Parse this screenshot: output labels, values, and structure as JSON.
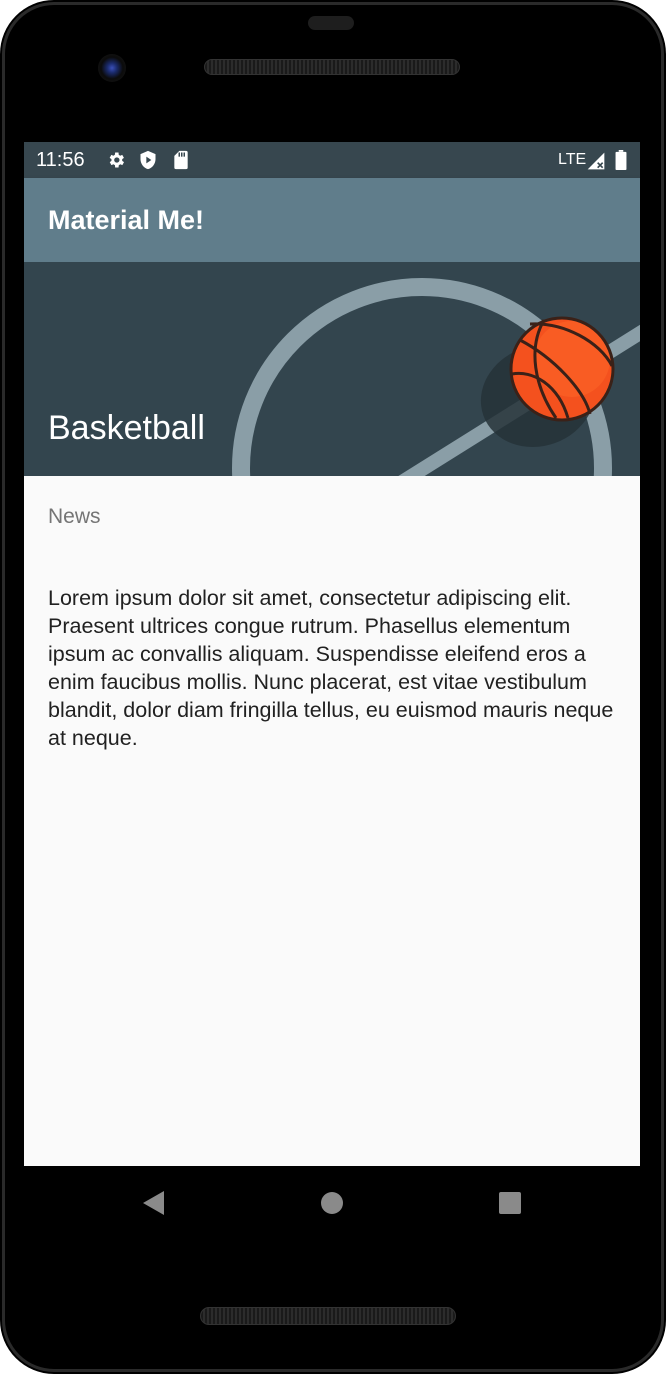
{
  "status_bar": {
    "time": "11:56",
    "icons": [
      "settings-icon",
      "play-protect-icon",
      "sd-card-icon"
    ],
    "network_label": "LTE",
    "right_icons": [
      "cell-signal-icon",
      "battery-icon"
    ]
  },
  "app_bar": {
    "title": "Material Me!"
  },
  "hero": {
    "title": "Basketball",
    "image_icon": "basketball-court-image"
  },
  "content": {
    "subtitle": "News",
    "body": "Lorem ipsum dolor sit amet, consectetur adipiscing elit. Praesent ultrices congue rutrum. Phasellus elementum ipsum ac convallis aliquam. Suspendisse eleifend eros a enim faucibus mollis. Nunc placerat, est vitae vestibulum blandit, dolor diam fringilla tellus, eu euismod mauris neque at neque."
  },
  "nav_bar": {
    "buttons": [
      "back-icon",
      "home-icon",
      "recents-icon"
    ]
  },
  "colors": {
    "status_bar": "#37474f",
    "app_bar": "#607d8b",
    "hero_background": "#33454e",
    "screen_background": "#fafafa",
    "ball": "#f4511e"
  }
}
